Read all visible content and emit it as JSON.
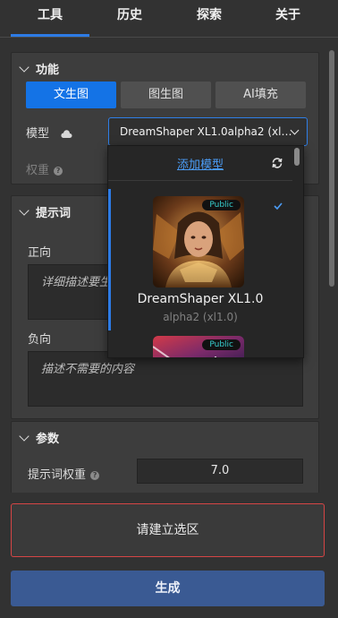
{
  "tabs": [
    {
      "label": "工具",
      "active": true
    },
    {
      "label": "历史",
      "active": false
    },
    {
      "label": "探索",
      "active": false
    },
    {
      "label": "关于",
      "active": false
    }
  ],
  "function_section": {
    "title": "功能",
    "modes": [
      "文生图",
      "图生图",
      "AI填充"
    ],
    "active_mode": "文生图",
    "model_label": "模型",
    "model_value": "DreamShaper XL1.0alpha2 (xl…",
    "weight_label": "权重"
  },
  "model_dropdown": {
    "add_model": "添加模型",
    "items": [
      {
        "name": "DreamShaper XL1.0",
        "sub": "alpha2 (xl1.0)",
        "badge": "Public",
        "selected": true
      },
      {
        "name": "",
        "sub": "",
        "badge": "Public",
        "selected": false
      }
    ]
  },
  "prompt_section": {
    "title": "提示词",
    "positive_label": "正向",
    "positive_placeholder": "详细描述要生",
    "negative_label": "负向",
    "negative_placeholder": "描述不需要的内容"
  },
  "params_section": {
    "title": "参数",
    "weight_label": "提示词权重",
    "weight_value": "7.0"
  },
  "selection_button": "请建立选区",
  "generate_button": "生成",
  "colors": {
    "accent": "#1473e6",
    "danger": "#d64545",
    "generate": "#3a5a93"
  }
}
